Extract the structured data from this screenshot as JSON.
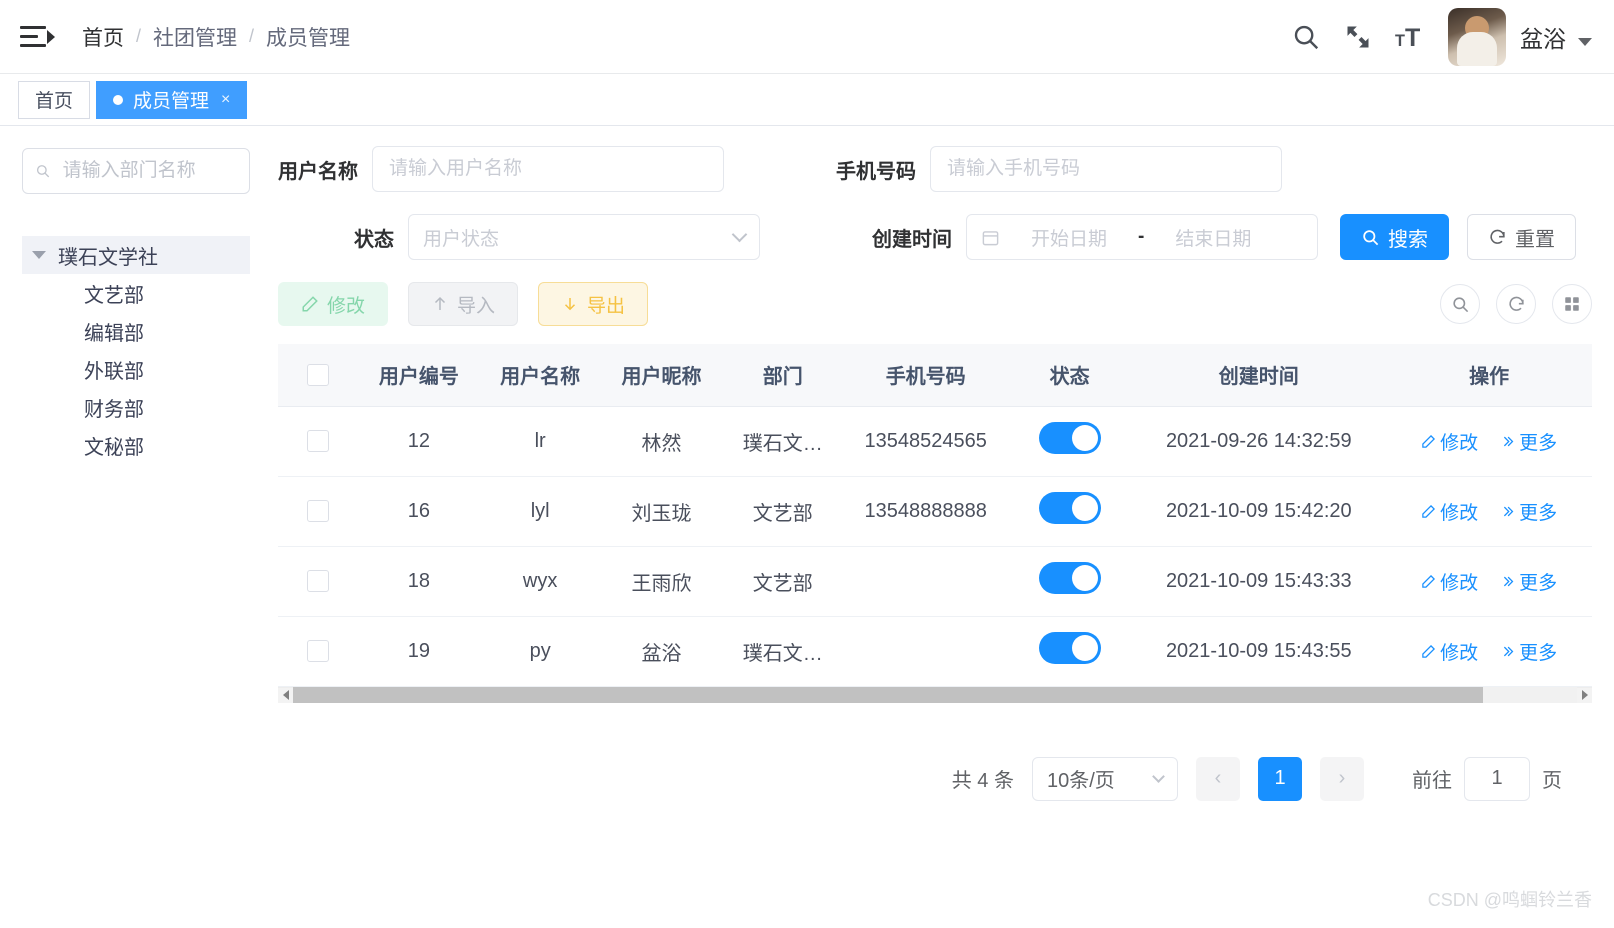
{
  "header": {
    "menu_icon": "hamburger-fold-icon",
    "breadcrumb": [
      "首页",
      "社团管理",
      "成员管理"
    ],
    "breadcrumb_sep": "/",
    "icons": [
      "search-icon",
      "fullscreen-icon",
      "font-size-icon"
    ],
    "user_name": "盆浴"
  },
  "tabs": [
    {
      "label": "首页",
      "active": false,
      "closable": false
    },
    {
      "label": "成员管理",
      "active": true,
      "closable": true,
      "close_label": "×"
    }
  ],
  "sidebar": {
    "search_placeholder": "请输入部门名称",
    "tree": {
      "root": "璞石文学社",
      "children": [
        "文艺部",
        "编辑部",
        "外联部",
        "财务部",
        "文秘部"
      ]
    }
  },
  "search_form": {
    "username": {
      "label": "用户名称",
      "placeholder": "请输入用户名称",
      "value": ""
    },
    "phone": {
      "label": "手机号码",
      "placeholder": "请输入手机号码",
      "value": ""
    },
    "status": {
      "label": "状态",
      "placeholder": "用户状态",
      "value": ""
    },
    "create_time": {
      "label": "创建时间",
      "start_placeholder": "开始日期",
      "end_placeholder": "结束日期",
      "separator": "-"
    },
    "search_button": "搜索",
    "reset_button": "重置"
  },
  "toolbar": {
    "edit": "修改",
    "import": "导入",
    "export": "导出",
    "right_icons": [
      "search-icon",
      "refresh-icon",
      "column-settings-icon"
    ]
  },
  "table": {
    "columns": [
      "用户编号",
      "用户名称",
      "用户昵称",
      "部门",
      "手机号码",
      "状态",
      "创建时间",
      "操作"
    ],
    "rows": [
      {
        "id": "12",
        "username": "lr",
        "nickname": "林然",
        "dept": "璞石文…",
        "phone": "13548524565",
        "status": true,
        "created": "2021-09-26 14:32:59",
        "actions": [
          "修改",
          "更多"
        ]
      },
      {
        "id": "16",
        "username": "lyl",
        "nickname": "刘玉珑",
        "dept": "文艺部",
        "phone": "13548888888",
        "status": true,
        "created": "2021-10-09 15:42:20",
        "actions": [
          "修改",
          "更多"
        ]
      },
      {
        "id": "18",
        "username": "wyx",
        "nickname": "王雨欣",
        "dept": "文艺部",
        "phone": "",
        "status": true,
        "created": "2021-10-09 15:43:33",
        "actions": [
          "修改",
          "更多"
        ]
      },
      {
        "id": "19",
        "username": "py",
        "nickname": "盆浴",
        "dept": "璞石文…",
        "phone": "",
        "status": true,
        "created": "2021-10-09 15:43:55",
        "actions": [
          "修改",
          "更多"
        ]
      }
    ]
  },
  "pagination": {
    "total_text": "共 4 条",
    "page_size": "10条/页",
    "prev": "‹",
    "next": "›",
    "current_page": "1",
    "jump_prefix": "前往",
    "jump_value": "1",
    "jump_suffix": "页"
  },
  "watermark": "CSDN @鸣蝈铃兰香",
  "colors": {
    "primary": "#1890ff",
    "tab_active": "#409eff",
    "edit_green": "#85d6ab",
    "export_yellow": "#f5c243",
    "link": "#1890ff"
  }
}
